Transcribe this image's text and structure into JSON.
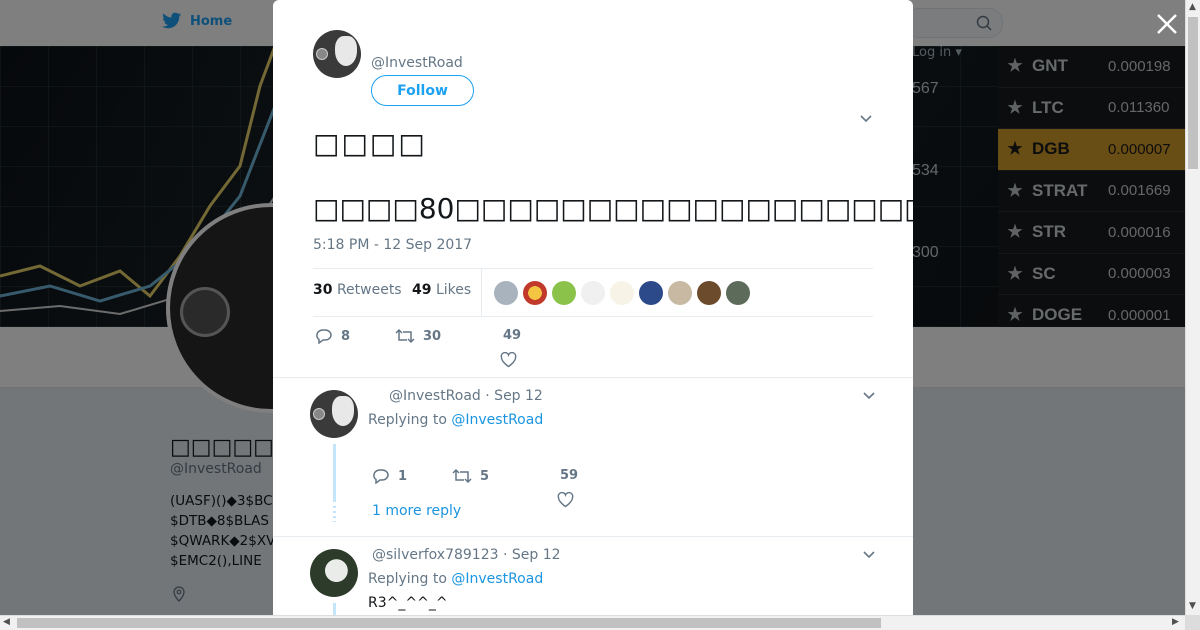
{
  "nav": {
    "home_label": "Home",
    "login_label": "Log in"
  },
  "banner": {
    "numbers": [
      "567",
      "534",
      "300"
    ],
    "ticker": [
      {
        "symbol": "GNT",
        "value": "0.000198"
      },
      {
        "symbol": "LTC",
        "value": "0.011360"
      },
      {
        "symbol": "DGB",
        "value": "0.000007",
        "highlight": true
      },
      {
        "symbol": "STRAT",
        "value": "0.001669"
      },
      {
        "symbol": "STR",
        "value": "0.000016"
      },
      {
        "symbol": "SC",
        "value": "0.000003"
      },
      {
        "symbol": "DOGE",
        "value": "0.000001"
      }
    ]
  },
  "profile": {
    "name": "□□□□□□□",
    "handle": "@InvestRoad",
    "bio": "(UASF)()◆3$BC\n$DTB◆8$BLAS\n$QWARK◆2$XV\n$EMC2(),LINE"
  },
  "tweet": {
    "handle": "@InvestRoad",
    "follow_label": "Follow",
    "title": "□□□□",
    "text": "□□□□80□□□□□□□□□□□□□□□□□□□□□□□□□□□□□□□□□□□□□□□□□□□□",
    "time": "5:18 PM - 12 Sep 2017",
    "retweets_count": "30",
    "retweets_label": "Retweets",
    "likes_count": "49",
    "likes_label": "Likes",
    "actions": {
      "replies": "8",
      "retweets": "30",
      "likes": "49"
    }
  },
  "replies": [
    {
      "handle": "@InvestRoad",
      "date": "· Sep 12",
      "replying_prefix": "Replying to",
      "replying_to": "@InvestRoad",
      "text": "",
      "actions": {
        "replies": "1",
        "retweets": "5",
        "likes": "59"
      },
      "more_replies": "1 more reply"
    },
    {
      "handle": "@silverfox789123",
      "date": "· Sep 12",
      "replying_prefix": "Replying to",
      "replying_to": "@InvestRoad",
      "text": "R3^_^^_^"
    }
  ],
  "colors": {
    "accent": "#1da1f2",
    "link": "#1b95e0",
    "secondary": "#657786"
  }
}
